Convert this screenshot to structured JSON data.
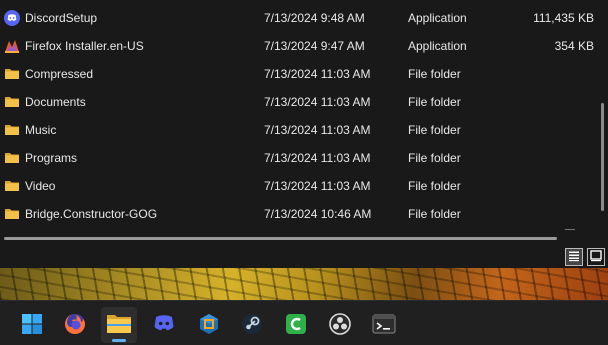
{
  "files": [
    {
      "name": "DiscordSetup",
      "date": "7/13/2024 9:48 AM",
      "type": "Application",
      "size": "111,435 KB",
      "icon": "discord-icon"
    },
    {
      "name": "Firefox Installer.en-US",
      "date": "7/13/2024 9:47 AM",
      "type": "Application",
      "size": "354 KB",
      "icon": "firefox-installer-icon"
    },
    {
      "name": "Compressed",
      "date": "7/13/2024 11:03 AM",
      "type": "File folder",
      "size": "",
      "icon": "folder-icon"
    },
    {
      "name": "Documents",
      "date": "7/13/2024 11:03 AM",
      "type": "File folder",
      "size": "",
      "icon": "folder-icon"
    },
    {
      "name": "Music",
      "date": "7/13/2024 11:03 AM",
      "type": "File folder",
      "size": "",
      "icon": "folder-icon"
    },
    {
      "name": "Programs",
      "date": "7/13/2024 11:03 AM",
      "type": "File folder",
      "size": "",
      "icon": "folder-icon"
    },
    {
      "name": "Video",
      "date": "7/13/2024 11:03 AM",
      "type": "File folder",
      "size": "",
      "icon": "folder-icon"
    },
    {
      "name": "Bridge.Constructor-GOG",
      "date": "7/13/2024 10:46 AM",
      "type": "File folder",
      "size": "",
      "icon": "folder-icon"
    }
  ],
  "view_buttons": [
    "details-view-icon",
    "large-icons-view-icon"
  ],
  "taskbar": {
    "apps": [
      {
        "name": "start",
        "icon": "windows-start-icon",
        "active": false
      },
      {
        "name": "firefox",
        "icon": "firefox-icon",
        "active": false
      },
      {
        "name": "file-explorer",
        "icon": "folder-icon",
        "active": true
      },
      {
        "name": "discord",
        "icon": "discord-icon",
        "active": false
      },
      {
        "name": "virtualbox",
        "icon": "virtualbox-icon",
        "active": false
      },
      {
        "name": "steam",
        "icon": "steam-icon",
        "active": false
      },
      {
        "name": "camtasia",
        "icon": "camtasia-icon",
        "active": false
      },
      {
        "name": "obs",
        "icon": "obs-icon",
        "active": false
      },
      {
        "name": "terminal",
        "icon": "terminal-icon",
        "active": false
      }
    ]
  },
  "colors": {
    "background": "#191919",
    "folder": "#f2c14a",
    "discord": "#5865f2",
    "taskbar": "#202020",
    "active_indicator": "#5fb2f2"
  }
}
